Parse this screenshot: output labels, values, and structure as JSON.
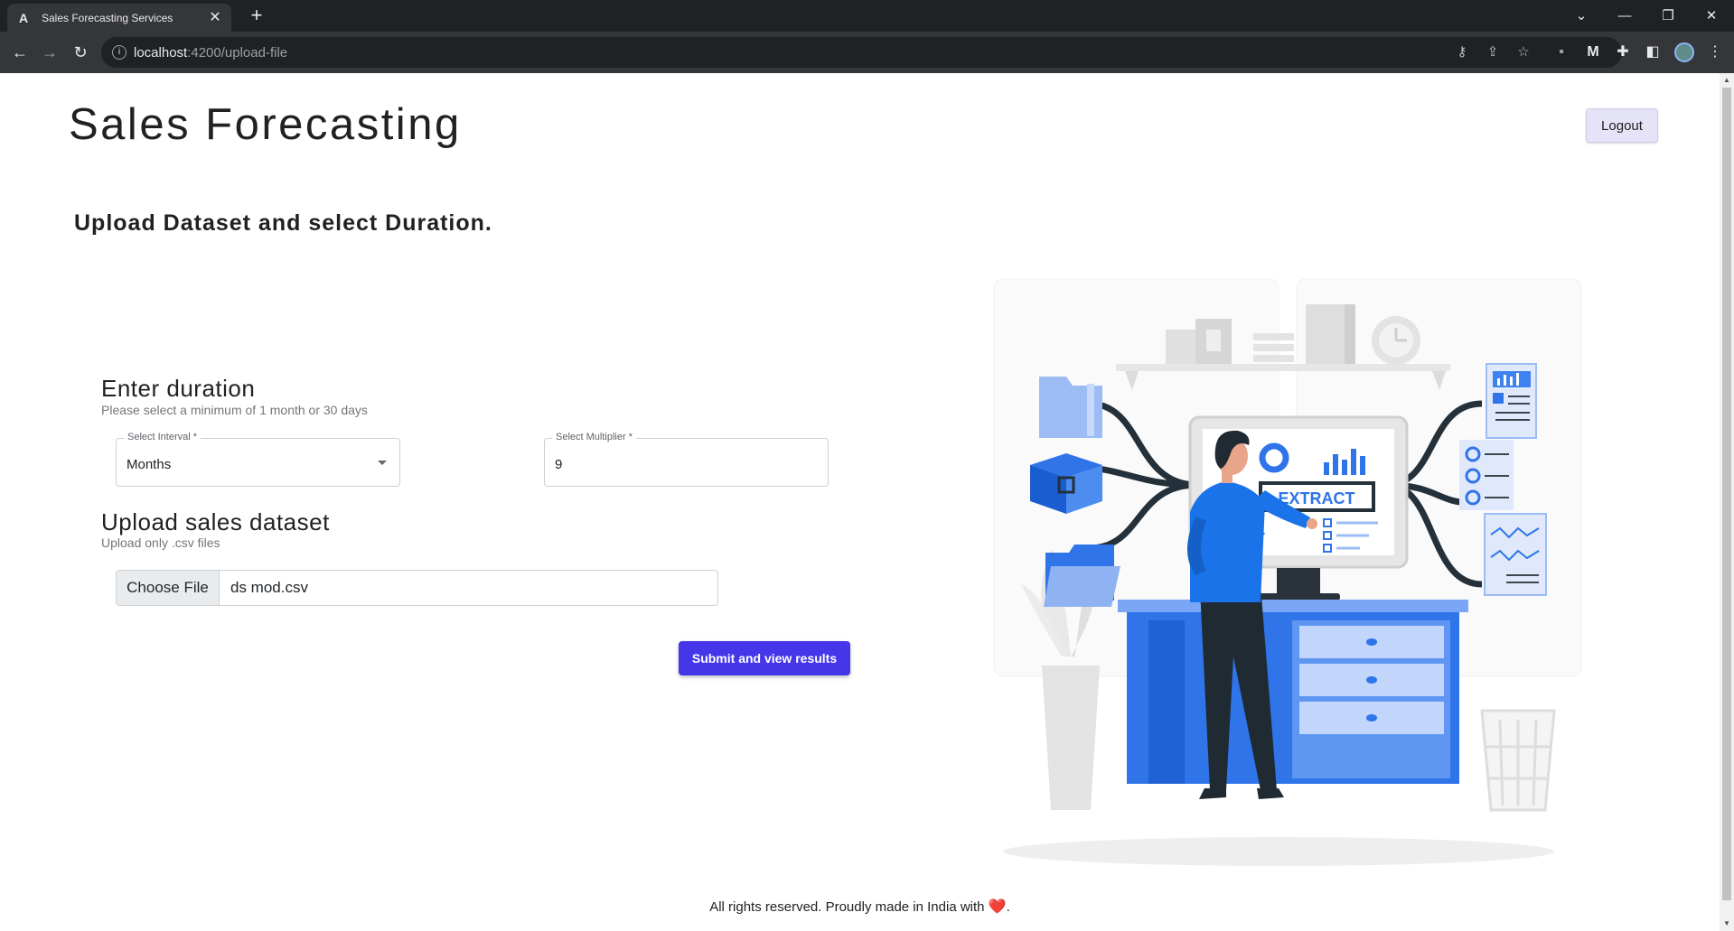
{
  "browser": {
    "tab_title": "Sales Forecasting Services",
    "tab_favicon": "A",
    "url_host": "localhost",
    "url_path": ":4200/upload-file"
  },
  "header": {
    "title": "Sales Forecasting",
    "logout_label": "Logout"
  },
  "page": {
    "subtitle": "Upload Dataset and select Duration."
  },
  "duration": {
    "title": "Enter duration",
    "hint": "Please select a minimum of 1 month or 30 days",
    "interval_label": "Select Interval *",
    "interval_value": "Months",
    "multiplier_label": "Select Multiplier *",
    "multiplier_value": "9"
  },
  "upload": {
    "title": "Upload sales dataset",
    "hint": "Upload only .csv files",
    "choose_label": "Choose File",
    "file_name": "ds mod.csv"
  },
  "submit_label": "Submit and view results",
  "illustration": {
    "screen_text": "EXTRACT"
  },
  "footer": {
    "text": "All rights reserved. Proudly made in India with",
    "suffix": "."
  },
  "colors": {
    "primary": "#4536ea",
    "illustration_blue": "#1a73e8",
    "heart": "#e02424"
  }
}
